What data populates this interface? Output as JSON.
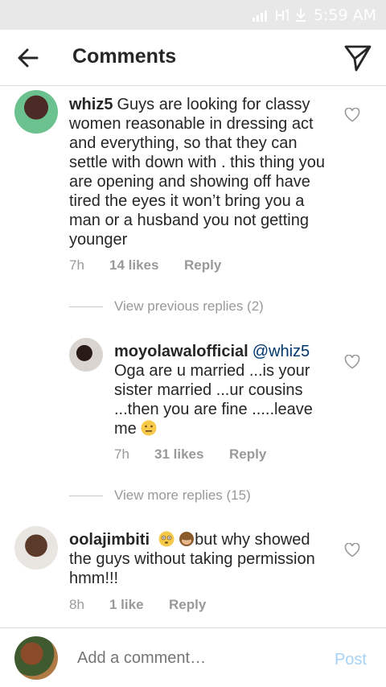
{
  "status": {
    "time": "5:59 AM"
  },
  "header": {
    "title": "Comments"
  },
  "comments": [
    {
      "username": "whiz5",
      "text": "Guys are looking for classy women reasonable in dressing act and everything, so that they can settle with down with . this thing you are opening and showing off have tired the eyes it won’t bring you a man or a husband you not getting younger",
      "time": "7h",
      "likes": "14 likes",
      "reply": "Reply"
    }
  ],
  "replies_links": {
    "previous": "View previous replies (2)",
    "more": "View more replies (15)"
  },
  "reply_comment": {
    "username": "moyolawalofficial",
    "mention": "@whiz5",
    "text": "Oga are u married ...is your sister married ...ur cousins ...then you are fine .....leave me",
    "time": "7h",
    "likes": "31 likes",
    "reply": "Reply"
  },
  "third_comment": {
    "username": "oolajimbiti",
    "text": "but why showed the guys without taking permission hmm!!!",
    "time": "8h",
    "likes": "1 like",
    "reply": "Reply"
  },
  "composer": {
    "placeholder": "Add a comment…",
    "post_label": "Post"
  },
  "colors": {
    "link_blue": "#003569",
    "post_blue_disabled": "#a7d2f5"
  }
}
